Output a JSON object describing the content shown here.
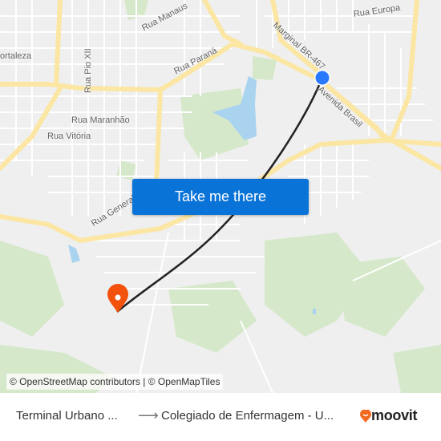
{
  "map": {
    "street_labels": [
      "Rua Manaus",
      "Rua Europa",
      "Marginal BR-467",
      "ortaleza",
      "Rua Pio XII",
      "Rua Paraná",
      "Avenida Brasil",
      "Rua Maranhão",
      "Rua Vitória",
      "Rua General Osório"
    ],
    "attribution": "© OpenStreetMap contributors | © OpenMapTiles",
    "colors": {
      "background": "#efefef",
      "major_road": "#fbe6a3",
      "minor_road": "#ffffff",
      "park": "#d5e8c9",
      "water": "#a9d3ef",
      "route_line": "#222222",
      "origin_marker": "#2979ff",
      "destination_marker": "#f2520c"
    }
  },
  "cta": {
    "label": "Take me there",
    "color": "#0a73d8"
  },
  "footer": {
    "origin": "Terminal Urbano ...",
    "arrow_icon": "arrow-right-icon",
    "destination": "Colegiado de Enfermagem - U...",
    "brand": "moovit",
    "brand_color": "#f26a21"
  }
}
